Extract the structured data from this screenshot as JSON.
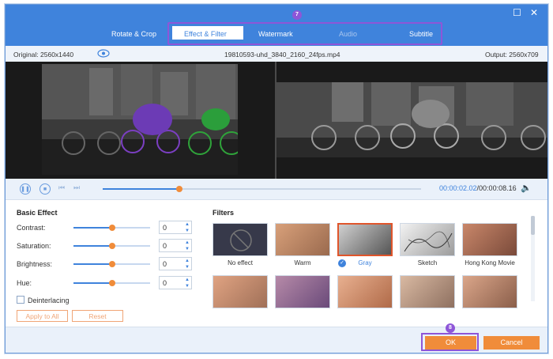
{
  "tabs": [
    {
      "label": "Rotate & Crop",
      "state": "normal"
    },
    {
      "label": "Effect & Filter",
      "state": "active"
    },
    {
      "label": "Watermark",
      "state": "normal"
    },
    {
      "label": "Audio",
      "state": "disabled"
    },
    {
      "label": "Subtitle",
      "state": "normal"
    }
  ],
  "badges": {
    "step_tabs": "7",
    "step_ok": "8"
  },
  "window": {
    "maximize_icon": "maximize-icon",
    "close_icon": "close-icon"
  },
  "info": {
    "original": "Original: 2560x1440",
    "filename": "19810593-uhd_3840_2160_24fps.mp4",
    "output": "Output: 2560x709"
  },
  "playback": {
    "current_time": "00:00:02.02",
    "total_time": "/00:00:08.16",
    "progress": 0.24
  },
  "basic_effect": {
    "title": "Basic Effect",
    "sliders": [
      {
        "label": "Contrast:",
        "value": "0",
        "level": 0.5
      },
      {
        "label": "Saturation:",
        "value": "0",
        "level": 0.5
      },
      {
        "label": "Brightness:",
        "value": "0",
        "level": 0.5
      },
      {
        "label": "Hue:",
        "value": "0",
        "level": 0.5
      }
    ],
    "deinterlacing_label": "Deinterlacing",
    "deinterlacing_checked": false,
    "apply_all_label": "Apply to All",
    "reset_label": "Reset"
  },
  "filters": {
    "title": "Filters",
    "items": [
      {
        "label": "No effect"
      },
      {
        "label": "Warm"
      },
      {
        "label": "Gray",
        "selected": true
      },
      {
        "label": "Sketch"
      },
      {
        "label": "Hong Kong Movie"
      }
    ]
  },
  "footer": {
    "ok_label": "OK",
    "cancel_label": "Cancel"
  },
  "colors": {
    "accent": "#3f83dc",
    "orange": "#f08c3a",
    "highlight": "#8e56d8"
  }
}
